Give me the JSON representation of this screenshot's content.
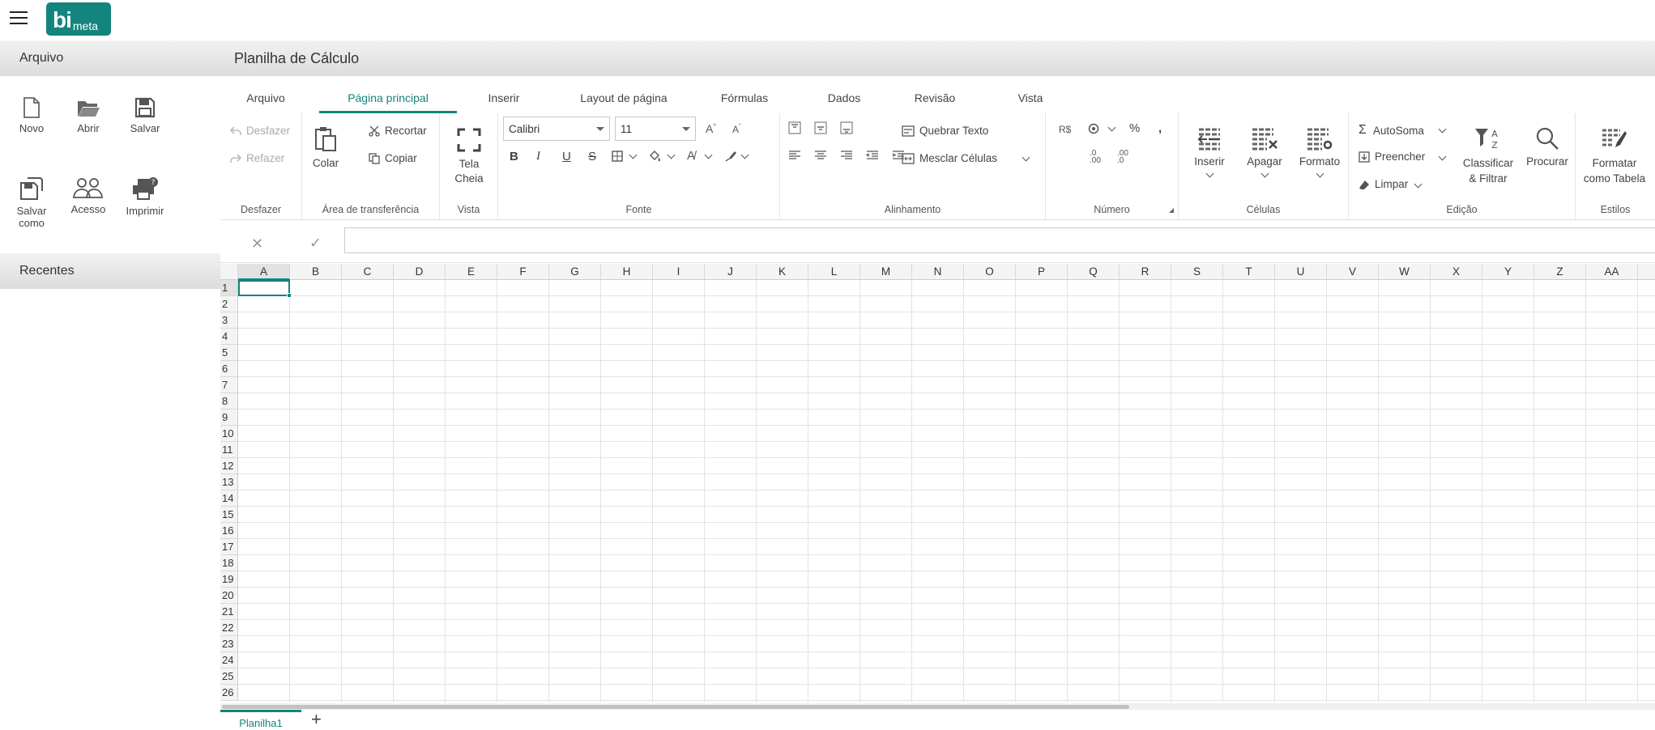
{
  "brand": {
    "logo_main": "bi",
    "logo_sub": "meta",
    "color": "#13847e"
  },
  "left_panel": {
    "file_title": "Arquivo",
    "actions": [
      {
        "label": "Novo",
        "icon": "new-file-icon"
      },
      {
        "label": "Abrir",
        "icon": "folder-open-icon"
      },
      {
        "label": "Salvar",
        "icon": "save-icon"
      },
      {
        "label": "Salvar como",
        "icon": "save-as-icon"
      },
      {
        "label": "Acesso",
        "icon": "users-icon"
      },
      {
        "label": "Imprimir",
        "icon": "print-icon"
      }
    ],
    "recent_title": "Recentes"
  },
  "title": "Planilha de Cálculo",
  "tabs": [
    {
      "label": "Arquivo"
    },
    {
      "label": "Página principal",
      "active": true
    },
    {
      "label": "Inserir"
    },
    {
      "label": "Layout de página"
    },
    {
      "label": "Fórmulas"
    },
    {
      "label": "Dados"
    },
    {
      "label": "Revisão"
    },
    {
      "label": "Vista"
    }
  ],
  "ribbon": {
    "undo": {
      "group": "Desfazer",
      "undo": "Desfazer",
      "redo": "Refazer"
    },
    "clipboard": {
      "group": "Área de transferência",
      "paste": "Colar",
      "cut": "Recortar",
      "copy": "Copiar"
    },
    "view": {
      "group": "Vista",
      "fullscreen": "Tela Cheia"
    },
    "font": {
      "group": "Fonte",
      "family": "Calibri",
      "size": "11"
    },
    "alignment": {
      "group": "Alinhamento",
      "wrap": "Quebrar Texto",
      "merge": "Mesclar Células"
    },
    "number": {
      "group": "Número",
      "currency": "R$"
    },
    "cells": {
      "group": "Células",
      "insert": "Inserir",
      "delete": "Apagar",
      "format": "Formato"
    },
    "editing": {
      "group": "Edição",
      "autosum": "AutoSoma",
      "fill": "Preencher",
      "clear": "Limpar",
      "sort": "Classificar & Filtrar",
      "find": "Procurar"
    },
    "styles": {
      "group": "Estilos",
      "format_table": "Formatar como Tabela"
    }
  },
  "formula_bar": {
    "cancel": "✕",
    "enter": "✓",
    "value": ""
  },
  "grid": {
    "columns": [
      "A",
      "B",
      "C",
      "D",
      "E",
      "F",
      "G",
      "H",
      "I",
      "J",
      "K",
      "L",
      "M",
      "N",
      "O",
      "P",
      "Q",
      "R",
      "S",
      "T",
      "U",
      "V",
      "W",
      "X",
      "Y",
      "Z",
      "AA"
    ],
    "rows": [
      "1",
      "2",
      "3",
      "4",
      "5",
      "6",
      "7",
      "8",
      "9",
      "10",
      "11",
      "12",
      "13",
      "14",
      "15",
      "16",
      "17",
      "18",
      "19",
      "20",
      "21",
      "22",
      "23",
      "24",
      "25",
      "26"
    ],
    "selected_cell": "A1"
  },
  "sheets": [
    {
      "label": "Planilha1",
      "active": true
    }
  ],
  "add_sheet": "+"
}
